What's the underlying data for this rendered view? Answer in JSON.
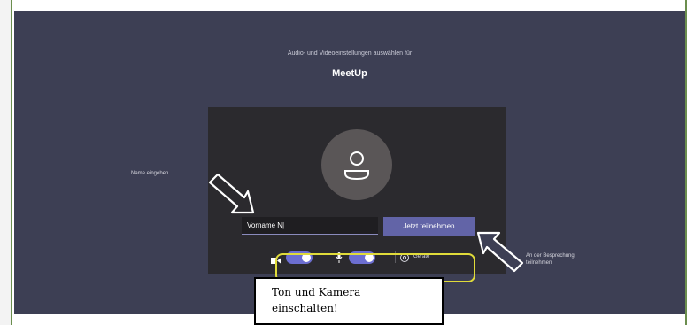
{
  "header": {
    "subtitle": "Audio- und Videoeinstellungen auswählen für",
    "title": "MeetUp"
  },
  "join_form": {
    "name_value": "Vorname N|",
    "join_label": "Jetzt teilnehmen"
  },
  "controls": {
    "camera_on": true,
    "microphone_on": true,
    "devices_label": "Geräte"
  },
  "annotations": {
    "name_hint": "Name eingeben",
    "join_hint_line1": "An der Besprechung",
    "join_hint_line2": "teilnehmen",
    "callout_line1": "Ton und Kamera",
    "callout_line2": "einschalten!"
  },
  "colors": {
    "background": "#3d3f54",
    "card": "#2b2a2e",
    "accent": "#6264a7",
    "highlight": "#e0db3a"
  },
  "icons": [
    "user-avatar-icon",
    "video-camera-icon",
    "microphone-icon",
    "gear-icon",
    "arrow-icon"
  ]
}
